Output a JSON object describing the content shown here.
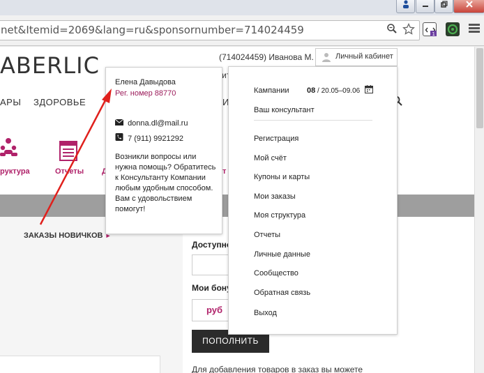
{
  "browser": {
    "url_text": "net&Itemid=2069&lang=ru&sponsornumber=714024459"
  },
  "header": {
    "logo_text": "ABERLIC",
    "user_info": "(714024459) Иванова М.",
    "cabinet_label": "Личный кабинет",
    "peek_it": "ит"
  },
  "nav": {
    "items": [
      "АРЫ",
      "ЗДОРОВЬЕ"
    ],
    "peek_in": "ИН"
  },
  "shortcuts": {
    "structure_label": "руктура",
    "reports_label": "Отчеты",
    "peek_d": "Д",
    "peek_t": "т"
  },
  "content": {
    "news_link": "ЗАКАЗЫ НОВИЧКОВ",
    "available_label": "Доступно",
    "bonus_label": "Мои бону",
    "rub": "руб",
    "topup_button": "ПОПОЛНИТЬ",
    "hint": "Для добавления товаров в заказ вы можете"
  },
  "consultant": {
    "name": "Елена Давыдова",
    "reg_number": "Рег. номер 88770",
    "email": "donna.dl@mail.ru",
    "phone": "7 (911) 9921292",
    "help_text": "Возникли вопросы или нужна помощь? Обратитесь к Консультанту Компании любым удобным способом. Вам с удовольствием помогут!"
  },
  "dropdown": {
    "campaign_label": "Кампании",
    "campaign_number": "08",
    "campaign_dates": " / 20.05–09.06",
    "consultant_link": "Ваш консультант",
    "items": [
      "Регистрация",
      "Мой счёт",
      "Купоны и карты",
      "Мои заказы",
      "Моя структура",
      "Отчеты",
      "Личные данные",
      "Сообщество",
      "Обратная связь",
      "Выход"
    ]
  },
  "colors": {
    "accent": "#b0226a",
    "annotation_arrow": "#e0201c"
  }
}
